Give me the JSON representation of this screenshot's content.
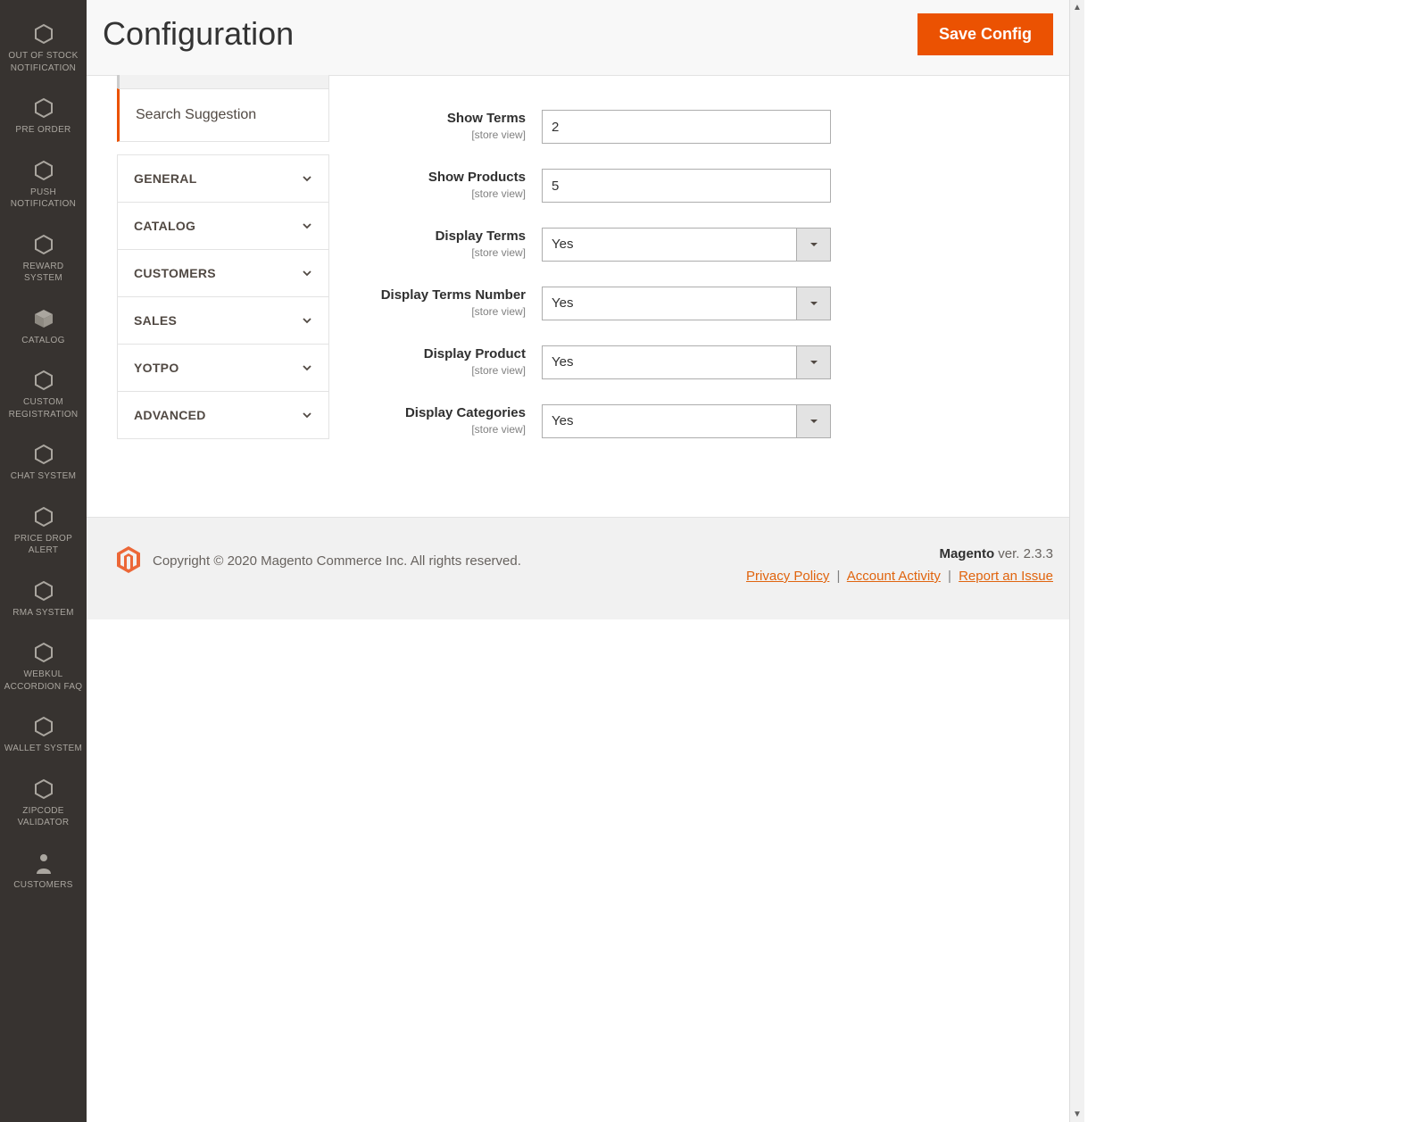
{
  "sidebar": {
    "items": [
      {
        "label": "OUT OF STOCK NOTIFICATION",
        "icon": "hex"
      },
      {
        "label": "PRE ORDER",
        "icon": "hex"
      },
      {
        "label": "PUSH NOTIFICATION",
        "icon": "hex"
      },
      {
        "label": "REWARD SYSTEM",
        "icon": "hex"
      },
      {
        "label": "CATALOG",
        "icon": "cube"
      },
      {
        "label": "CUSTOM REGISTRATION",
        "icon": "hex"
      },
      {
        "label": "CHAT SYSTEM",
        "icon": "hex"
      },
      {
        "label": "PRICE DROP ALERT",
        "icon": "hex"
      },
      {
        "label": "RMA SYSTEM",
        "icon": "hex"
      },
      {
        "label": "WEBKUL ACCORDION FAQ",
        "icon": "hex"
      },
      {
        "label": "WALLET SYSTEM",
        "icon": "hex"
      },
      {
        "label": "ZIPCODE VALIDATOR",
        "icon": "hex"
      },
      {
        "label": "CUSTOMERS",
        "icon": "person"
      }
    ]
  },
  "header": {
    "title": "Configuration",
    "save_label": "Save Config"
  },
  "configTabs": {
    "active_sub": "Search Suggestion",
    "sections": [
      "GENERAL",
      "CATALOG",
      "CUSTOMERS",
      "SALES",
      "YOTPO",
      "ADVANCED"
    ]
  },
  "form": {
    "scope": "[store view]",
    "fields": [
      {
        "label": "Show Terms",
        "type": "text",
        "value": "2"
      },
      {
        "label": "Show Products",
        "type": "text",
        "value": "5"
      },
      {
        "label": "Display Terms",
        "type": "select",
        "value": "Yes"
      },
      {
        "label": "Display Terms Number",
        "type": "select",
        "value": "Yes"
      },
      {
        "label": "Display Product",
        "type": "select",
        "value": "Yes"
      },
      {
        "label": "Display Categories",
        "type": "select",
        "value": "Yes"
      }
    ]
  },
  "footer": {
    "copyright": "Copyright © 2020 Magento Commerce Inc. All rights reserved.",
    "product": "Magento",
    "version": " ver. 2.3.3",
    "links": {
      "privacy": "Privacy Policy",
      "activity": "Account Activity",
      "report": "Report an Issue"
    }
  }
}
